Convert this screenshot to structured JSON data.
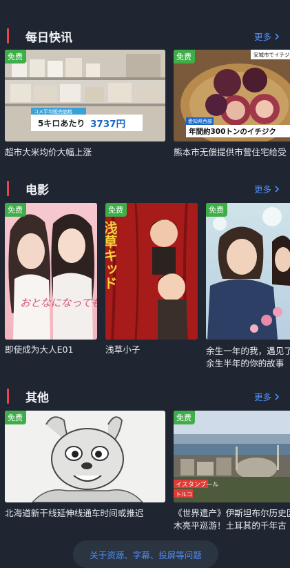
{
  "sections": [
    {
      "title": "每日快讯",
      "more": "更多",
      "cards": [
        {
          "badge": "免费",
          "caption": "超市大米均价大幅上涨",
          "overlay_label": "コメ平均販売価格",
          "overlay_price_prefix": "5キロあたり",
          "overlay_price": "3737円"
        },
        {
          "badge": "免费",
          "caption": "熊本市无偿提供市营住宅给受",
          "overlay_top": "安城市でイチジ",
          "overlay_region": "愛知県西部",
          "overlay_main": "年間約300トンのイチジク"
        }
      ]
    },
    {
      "title": "电影",
      "more": "更多",
      "cards": [
        {
          "badge": "免费",
          "caption": "即使成为大人E01",
          "poster_title": "おとなになっても"
        },
        {
          "badge": "免费",
          "caption": "浅草小子",
          "poster_title": "浅草キッド"
        },
        {
          "badge": "免费",
          "caption": "余生一年的我，遇见了",
          "caption_line2": "余生半年的你的故事"
        }
      ]
    },
    {
      "title": "其他",
      "more": "更多",
      "cards": [
        {
          "badge": "免费",
          "caption": "北海道新干线延伸线通车时间或推迟"
        },
        {
          "badge": "免费",
          "caption": "《世界遗产》伊斯坦布尔历史区",
          "caption_line2": "木亮平巡游！土耳其的千年古",
          "overlay_city": "イスタンブール",
          "overlay_country": "トルコ"
        }
      ]
    }
  ],
  "bottom_link": "关于资源、字幕、投屏等问题"
}
